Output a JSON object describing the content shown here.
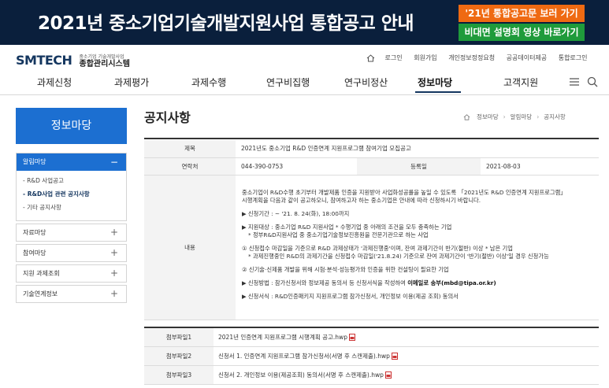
{
  "banner": {
    "title": "2021년 중소기업기술개발지원사업 통합공고 안내",
    "btn_notice": "'21년 통합공고문 보러 가기",
    "btn_video": "비대면 설명회 영상 바로가기",
    "btn_notice_color": "#ef6a12",
    "btn_video_color": "#1f9b3b"
  },
  "header": {
    "logo": "SMTECH",
    "logo_sub1": "중소기업 기술개발사업",
    "logo_sub2": "종합관리시스템",
    "util": [
      "로그인",
      "회원가입",
      "개인정보정정요청",
      "공공데이터제공",
      "통합로그인"
    ]
  },
  "gnb": {
    "items": [
      "과제신청",
      "과제평가",
      "과제수행",
      "연구비집행",
      "연구비정산",
      "정보마당",
      "고객지원"
    ],
    "active": "정보마당"
  },
  "sidebar": {
    "title": "정보마당",
    "group": "알림마당",
    "sub_items": [
      "- R&D 사업공고",
      "- R&D사업 관련 공지사항",
      "- 기타 공지사항"
    ],
    "items": [
      "자료마당",
      "참여마당",
      "지원 과제조회",
      "기술연계정보"
    ]
  },
  "page": {
    "title": "공지사항",
    "breadcrumb": [
      "정보마당",
      "알림마당",
      "공지사항"
    ]
  },
  "notice": {
    "subject_label": "제목",
    "subject": "2021년도 중소기업 R&D 인증연계 지원프로그램 참여기업 모집공고",
    "contact_label": "연락처",
    "contact": "044-390-0753",
    "date_label": "등록일",
    "date": "2021-08-03",
    "body_label": "내용",
    "body": {
      "intro1": "중소기업이 R&D수행 초기부터 개발제품 인증을 지원받아 사업화성공률을 높일 수 있도록 「2021년도 R&D 인증연계 지원프로그램」",
      "intro2": "시행계획을 다음과 같이 공고하오니, 참여하고자 하는 중소기업은 안내에 따라 신청하시기 바랍니다.",
      "period": "▶ 신청기간 : ~ '21. 8. 24(화), 18:00까지",
      "target1": "▶ 지원대상 : 중소기업 R&D 지원사업 *  수행기업 중 아래의 조건을 모두 충족하는 기업",
      "target2": "*  정부R&D지원사업 중 중소기업기술정보진흥원을 전문기관으로 하는 사업",
      "cond1": "① 신청접수 마감일을 기준으로 R&D 과제상태가 '과제진행중'이며, 잔여 과제기간이 반기(절반) 이상 * 남은 기업",
      "cond1b": "*  과제진행중인 R&D의 과제기간을 신청접수 마감일('21.8.24) 기준으로 잔여 과제기간이 '반기(절반) 이상'일 경우 신청가능",
      "cond2": "② 신기술·신제품 개발을 위해 시험·분석·성능평가와 인증을 위한 컨설팅이 필요한 기업",
      "method_prefix": "▶ 신청방법 : 참가신청서와 정보제공 동의서 등 신청서식을 작성하여 ",
      "method_email": "이메일로 송부(mbd@tipa.or.kr)",
      "forms": "▶ 신청서식 :  R&D인증패키지 지원프로그램 참가신청서, 개인정보 이용(제공 조회) 동의서"
    }
  },
  "attachments": [
    {
      "label": "첨부파일1",
      "file": "2021년 인증연계 지원프로그램 시행계획 공고.hwp"
    },
    {
      "label": "첨부파일2",
      "file": "신청서 1. 인증연계 지원프로그램 참가신청서(서명 후 스캔제출).hwp"
    },
    {
      "label": "첨부파일3",
      "file": "신청서 2. 개인정보 이용(제공조회) 동의서(서명 후 스캔제출).hwp"
    }
  ]
}
